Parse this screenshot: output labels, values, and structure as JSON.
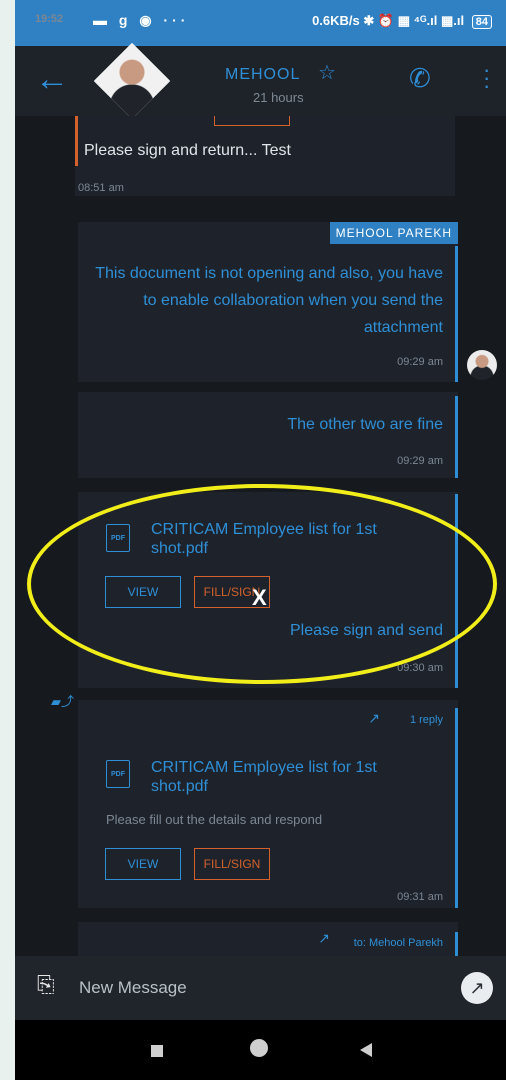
{
  "status_bar": {
    "time": "19:52",
    "icons": "▬ g ◉ ···",
    "network_speed": "0.6KB/s",
    "right_icons": "✱ ⏰ ▦ ⁴ᴳ.ıl ▦.ıl",
    "battery": "84"
  },
  "header": {
    "contact_name": "MEHOOL",
    "last_seen": "21 hours"
  },
  "messages": [
    {
      "text": "Please sign and return... Test",
      "time": "08:51 am"
    },
    {
      "sender": "MEHOOL PAREKH",
      "text": "This document is not opening and also, you have to enable collaboration when you send the attachment",
      "time": "09:29 am"
    },
    {
      "text": "The other two are fine",
      "time": "09:29 am"
    },
    {
      "file_name": "CRITICAM Employee list for 1st shot.pdf",
      "file_icon_label": "PDF",
      "view_label": "VIEW",
      "fill_label": "FILL/SIGN",
      "text": "Please sign and send",
      "time": "09:30 am"
    },
    {
      "reply_count": "1 reply",
      "file_name": "CRITICAM Employee list for 1st shot.pdf",
      "file_icon_label": "PDF",
      "note": "Please fill out the details and respond",
      "view_label": "VIEW",
      "fill_label": "FILL/SIGN",
      "time": "09:31 am"
    },
    {
      "to_label": "to: Mehool Parekh"
    }
  ],
  "annotation": {
    "mark": "X",
    "ellipse_color": "#f2ee1a"
  },
  "composer": {
    "placeholder": "New Message"
  },
  "colors": {
    "accent": "#2f8fd6",
    "orange": "#d2612c",
    "status_bar": "#2f81c4",
    "background": "#16191e"
  }
}
